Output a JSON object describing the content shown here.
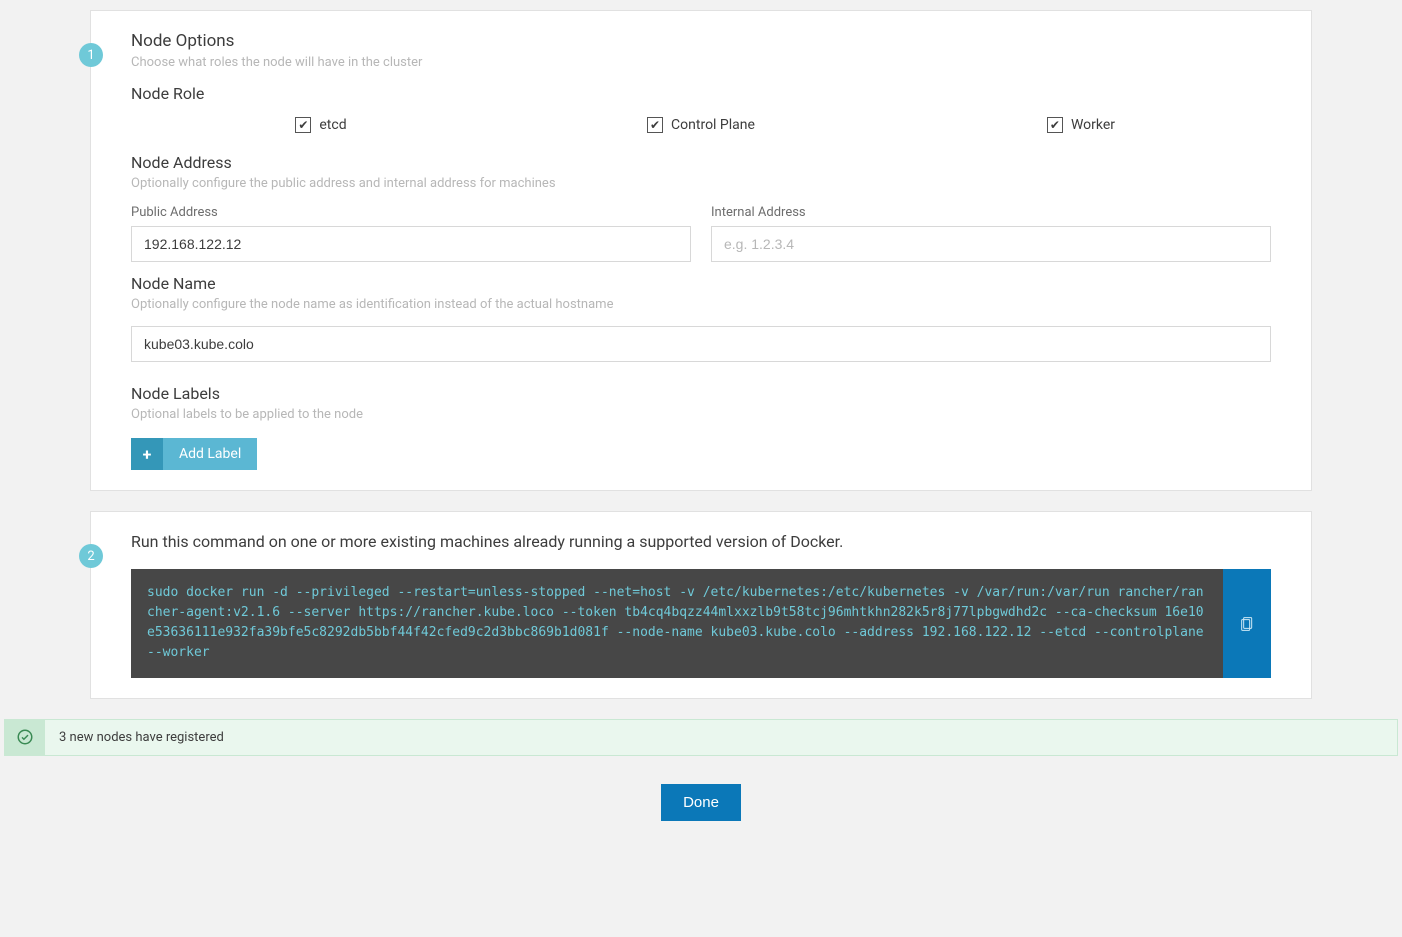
{
  "step1": {
    "badge": "1",
    "title": "Node Options",
    "subtitle": "Choose what roles the node will have in the cluster",
    "role_heading": "Node Role",
    "roles": {
      "etcd": "etcd",
      "controlplane": "Control Plane",
      "worker": "Worker"
    },
    "address_heading": "Node Address",
    "address_sub": "Optionally configure the public address and internal address for machines",
    "public_label": "Public Address",
    "public_value": "192.168.122.12",
    "internal_label": "Internal Address",
    "internal_placeholder": "e.g. 1.2.3.4",
    "name_heading": "Node Name",
    "name_sub": "Optionally configure the node name as identification instead of the actual hostname",
    "name_value": "kube03.kube.colo",
    "labels_heading": "Node Labels",
    "labels_sub": "Optional labels to be applied to the node",
    "add_label": "Add Label"
  },
  "step2": {
    "badge": "2",
    "description": "Run this command on one or more existing machines already running a supported version of Docker.",
    "command": "sudo docker run -d --privileged --restart=unless-stopped --net=host -v /etc/kubernetes:/etc/kubernetes -v /var/run:/var/run rancher/rancher-agent:v2.1.6 --server https://rancher.kube.loco --token tb4cq4bqzz44mlxxzlb9t58tcj96mhtkhn282k5r8j77lpbgwdhd2c --ca-checksum 16e10e53636111e932fa39bfe5c8292db5bbf44f42cfed9c2d3bbc869b1d081f --node-name kube03.kube.colo --address 192.168.122.12 --etcd --controlplane --worker"
  },
  "alert": "3 new nodes have registered",
  "done": "Done"
}
